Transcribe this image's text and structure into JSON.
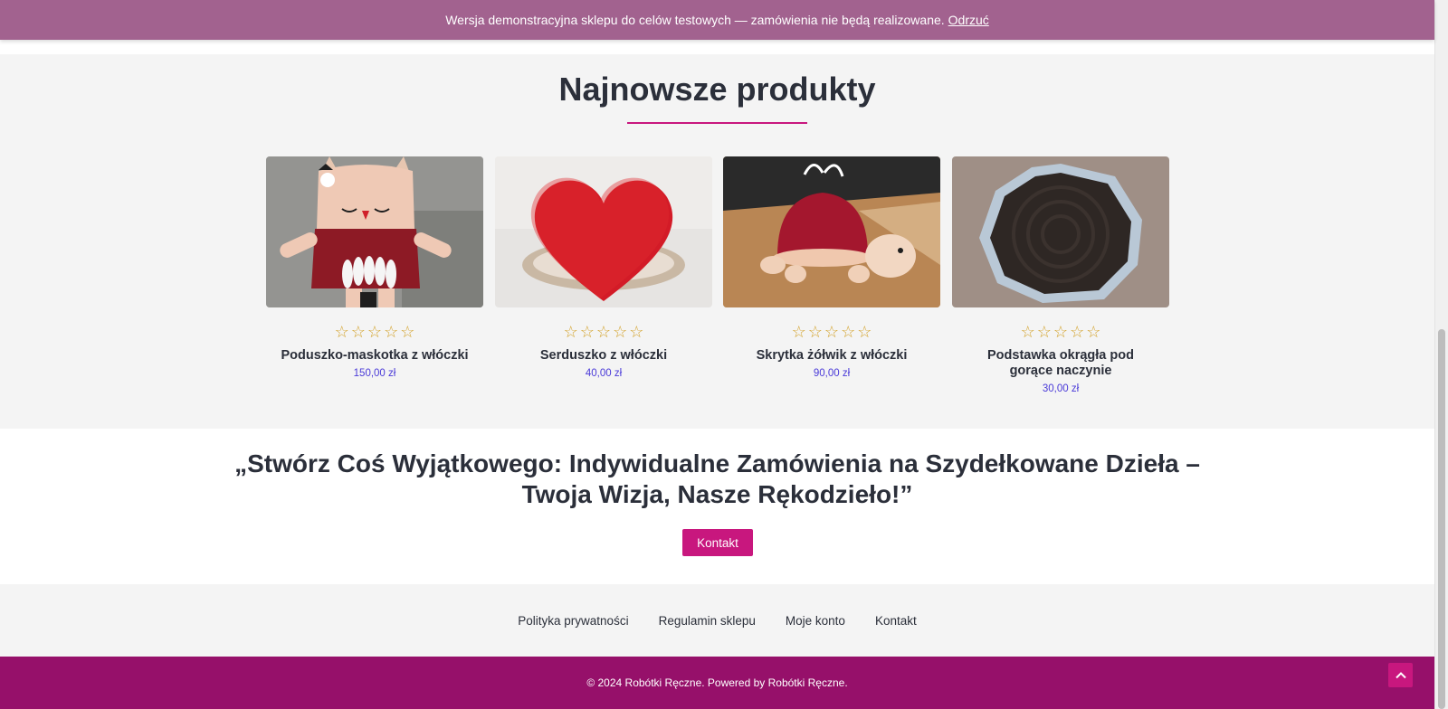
{
  "notice": {
    "text": "Wersja demonstracyjna sklepu do celów testowych — zamówienia nie będą realizowane.",
    "dismiss_label": "Odrzuć"
  },
  "products_section": {
    "title": "Najnowsze produkty",
    "products": [
      {
        "name": "Poduszko-maskotka z włóczki",
        "price": "150,00 zł",
        "rating_max": 5,
        "rating": 0,
        "image": "crochet-owl-pillow"
      },
      {
        "name": "Serduszko z włóczki",
        "price": "40,00 zł",
        "rating_max": 5,
        "rating": 0,
        "image": "crochet-red-heart"
      },
      {
        "name": "Skrytka żółwik z włóczki",
        "price": "90,00 zł",
        "rating_max": 5,
        "rating": 0,
        "image": "crochet-turtle-pouch"
      },
      {
        "name": "Podstawka okrągła pod gorące naczynie",
        "price": "30,00 zł",
        "rating_max": 5,
        "rating": 0,
        "image": "crochet-round-trivet"
      }
    ]
  },
  "cta": {
    "title": "„Stwórz Coś Wyjątkowego: Indywidualne Zamówienia na Szydełkowane Dzieła – Twoja Wizja, Nasze Rękodzieło!”",
    "button_label": "Kontakt"
  },
  "footer_nav": {
    "items": [
      "Polityka prywatności",
      "Regulamin sklepu",
      "Moje konto",
      "Kontakt"
    ]
  },
  "footer": {
    "copyright": "© 2024 Robótki Ręczne. Powered by Robótki Ręczne."
  },
  "icons": {
    "star": "star-outline-icon",
    "back_to_top": "chevron-up-icon"
  },
  "colors": {
    "notice_bg": "#a2628f",
    "accent": "#c8177e",
    "footer_bg": "#96106a",
    "price": "#4a3ad8",
    "star": "#d3a22a"
  }
}
